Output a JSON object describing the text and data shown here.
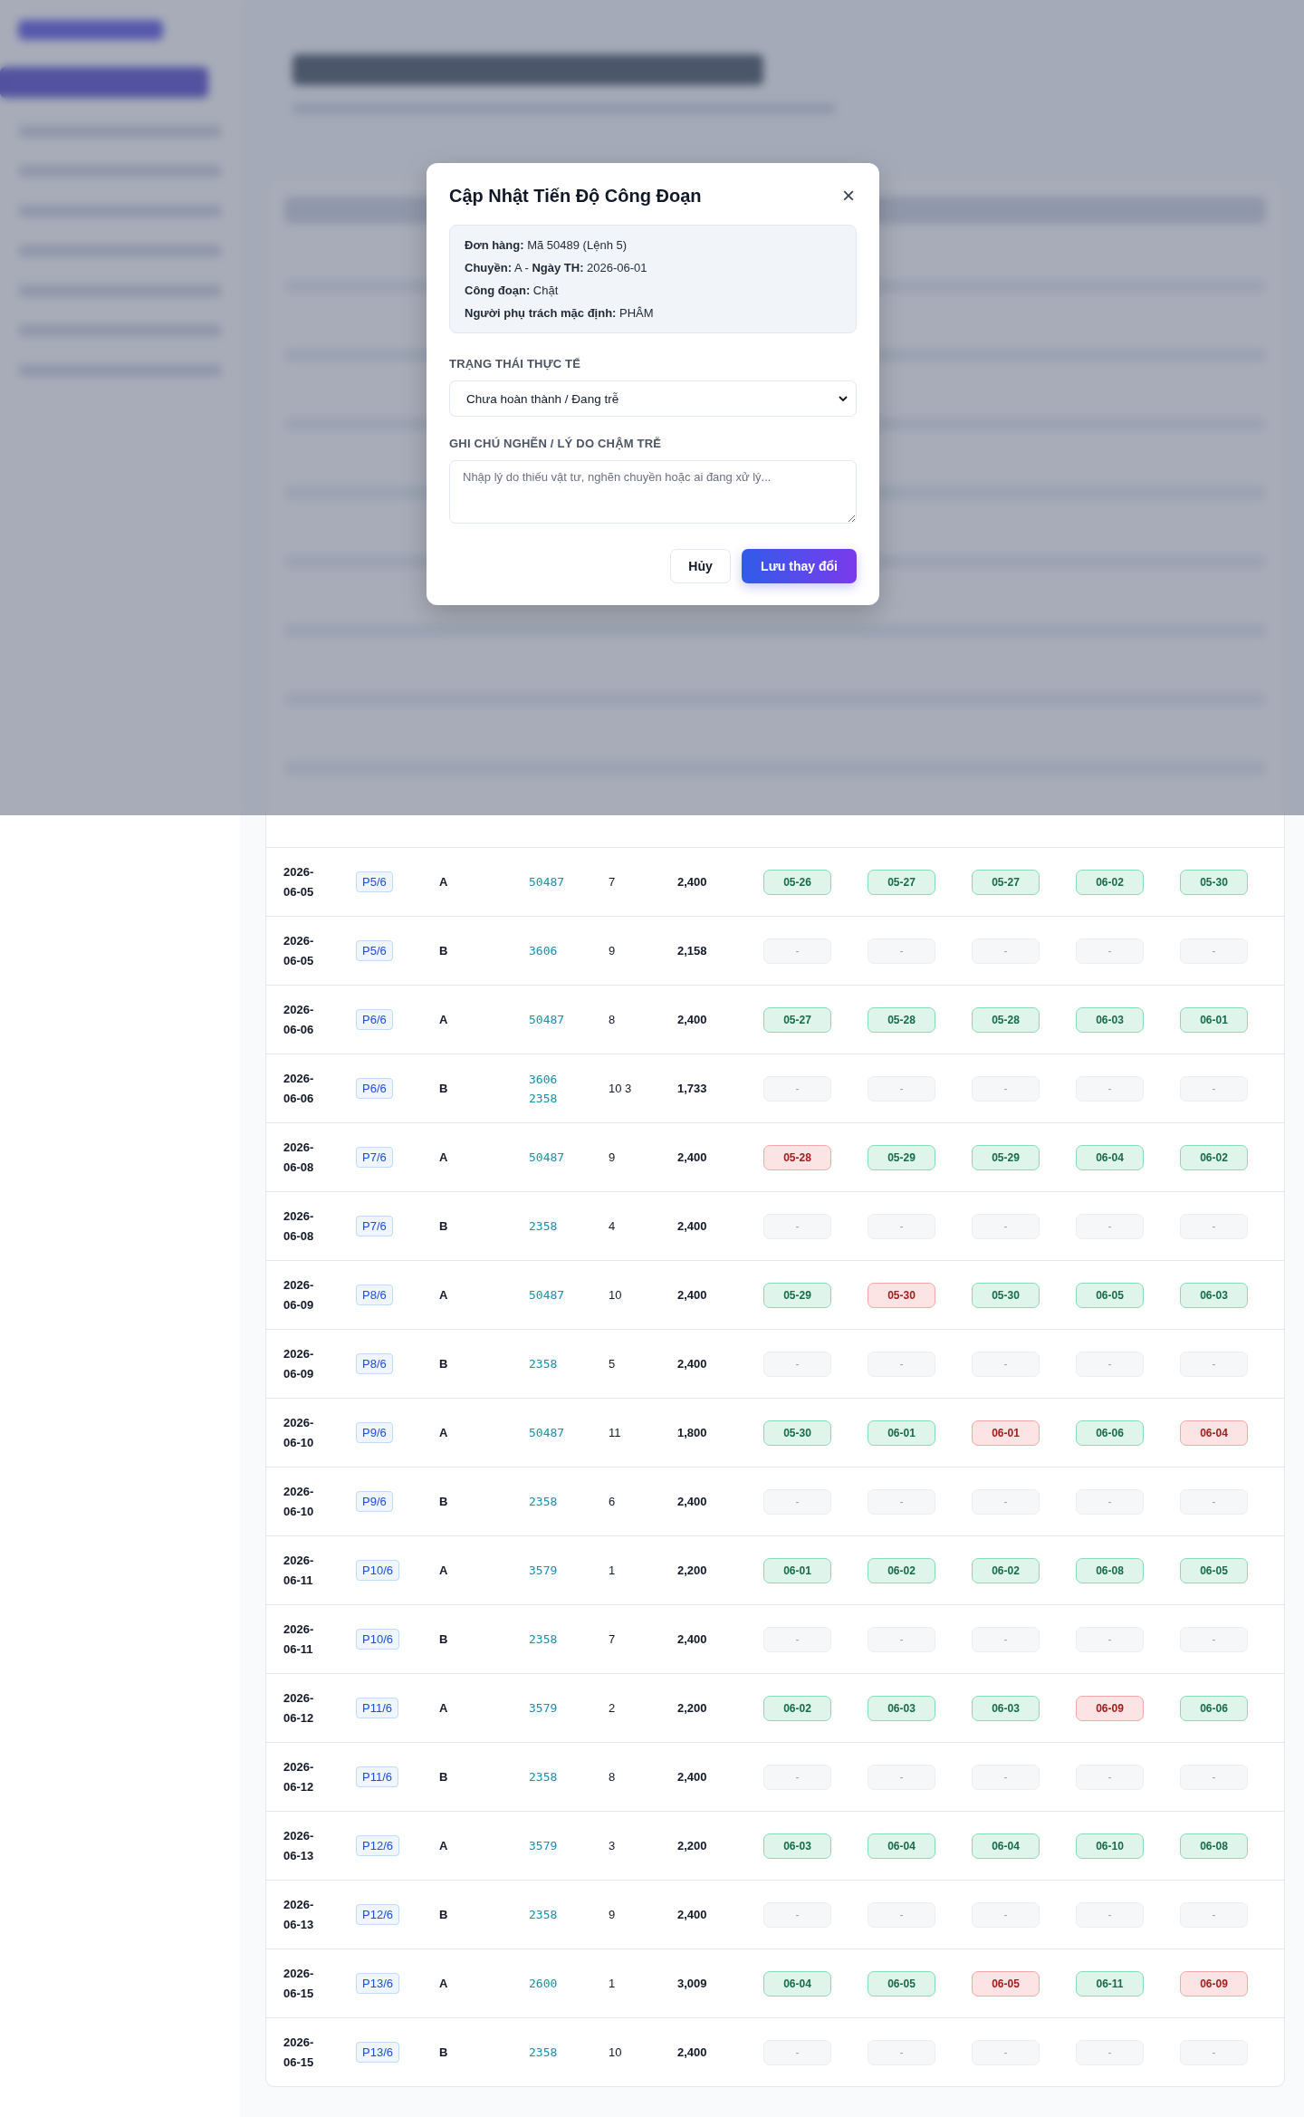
{
  "modal": {
    "title": "Cập Nhật Tiến Độ Công Đoạn",
    "close": "×",
    "info": [
      "**Đơn hàng:** Mã 50489 (Lệnh 5)",
      "**Chuyền:** A - **Ngày TH:** 2026-06-01",
      "**Công đoạn:** Chặt",
      "**Người phụ trách mặc định:** PHÂM"
    ],
    "status_label": "TRẠNG THÁI THỰC TẾ",
    "status_value": "Chưa hoàn thành / Đang trễ",
    "note_label": "GHI CHÚ NGHẼN / LÝ DO CHẬM TRỄ",
    "note_placeholder": "Nhập lý do thiếu vật tư, nghẽn chuyền hoặc ai đang xử lý...",
    "cancel": "Hủy",
    "save": "Lưu thay đổi"
  },
  "table": {
    "rows": [
      {
        "date": "2026-06-05",
        "plan": "P5/6",
        "line": "A",
        "codes": [
          "50487"
        ],
        "count": "7",
        "qty": "2,400",
        "stages": [
          {
            "text": "05-26",
            "kind": "done"
          },
          {
            "text": "05-27",
            "kind": "done"
          },
          {
            "text": "05-27",
            "kind": "done"
          },
          {
            "text": "06-02",
            "kind": "done"
          },
          {
            "text": "05-30",
            "kind": "done"
          }
        ]
      },
      {
        "date": "2026-06-05",
        "plan": "P5/6",
        "line": "B",
        "codes": [
          "3606"
        ],
        "count": "9",
        "qty": "2,158",
        "stages": [
          {
            "text": "-",
            "kind": "empty"
          },
          {
            "text": "-",
            "kind": "empty"
          },
          {
            "text": "-",
            "kind": "empty"
          },
          {
            "text": "-",
            "kind": "empty"
          },
          {
            "text": "-",
            "kind": "empty"
          }
        ]
      },
      {
        "date": "2026-06-06",
        "plan": "P6/6",
        "line": "A",
        "codes": [
          "50487"
        ],
        "count": "8",
        "qty": "2,400",
        "stages": [
          {
            "text": "05-27",
            "kind": "done"
          },
          {
            "text": "05-28",
            "kind": "done"
          },
          {
            "text": "05-28",
            "kind": "done"
          },
          {
            "text": "06-03",
            "kind": "done"
          },
          {
            "text": "06-01",
            "kind": "done"
          }
        ]
      },
      {
        "date": "2026-06-06",
        "plan": "P6/6",
        "line": "B",
        "codes": [
          "3606",
          "2358"
        ],
        "count": "10 3",
        "qty": "1,733",
        "stages": [
          {
            "text": "-",
            "kind": "empty"
          },
          {
            "text": "-",
            "kind": "empty"
          },
          {
            "text": "-",
            "kind": "empty"
          },
          {
            "text": "-",
            "kind": "empty"
          },
          {
            "text": "-",
            "kind": "empty"
          }
        ]
      },
      {
        "date": "2026-06-08",
        "plan": "P7/6",
        "line": "A",
        "codes": [
          "50487"
        ],
        "count": "9",
        "qty": "2,400",
        "stages": [
          {
            "text": "05-28",
            "kind": "late"
          },
          {
            "text": "05-29",
            "kind": "done"
          },
          {
            "text": "05-29",
            "kind": "done"
          },
          {
            "text": "06-04",
            "kind": "done"
          },
          {
            "text": "06-02",
            "kind": "done"
          }
        ]
      },
      {
        "date": "2026-06-08",
        "plan": "P7/6",
        "line": "B",
        "codes": [
          "2358"
        ],
        "count": "4",
        "qty": "2,400",
        "stages": [
          {
            "text": "-",
            "kind": "empty"
          },
          {
            "text": "-",
            "kind": "empty"
          },
          {
            "text": "-",
            "kind": "empty"
          },
          {
            "text": "-",
            "kind": "empty"
          },
          {
            "text": "-",
            "kind": "empty"
          }
        ]
      },
      {
        "date": "2026-06-09",
        "plan": "P8/6",
        "line": "A",
        "codes": [
          "50487"
        ],
        "count": "10",
        "qty": "2,400",
        "stages": [
          {
            "text": "05-29",
            "kind": "done"
          },
          {
            "text": "05-30",
            "kind": "late"
          },
          {
            "text": "05-30",
            "kind": "done"
          },
          {
            "text": "06-05",
            "kind": "done"
          },
          {
            "text": "06-03",
            "kind": "done"
          }
        ]
      },
      {
        "date": "2026-06-09",
        "plan": "P8/6",
        "line": "B",
        "codes": [
          "2358"
        ],
        "count": "5",
        "qty": "2,400",
        "stages": [
          {
            "text": "-",
            "kind": "empty"
          },
          {
            "text": "-",
            "kind": "empty"
          },
          {
            "text": "-",
            "kind": "empty"
          },
          {
            "text": "-",
            "kind": "empty"
          },
          {
            "text": "-",
            "kind": "empty"
          }
        ]
      },
      {
        "date": "2026-06-10",
        "plan": "P9/6",
        "line": "A",
        "codes": [
          "50487"
        ],
        "count": "11",
        "qty": "1,800",
        "stages": [
          {
            "text": "05-30",
            "kind": "done"
          },
          {
            "text": "06-01",
            "kind": "done"
          },
          {
            "text": "06-01",
            "kind": "late"
          },
          {
            "text": "06-06",
            "kind": "done"
          },
          {
            "text": "06-04",
            "kind": "late"
          }
        ]
      },
      {
        "date": "2026-06-10",
        "plan": "P9/6",
        "line": "B",
        "codes": [
          "2358"
        ],
        "count": "6",
        "qty": "2,400",
        "stages": [
          {
            "text": "-",
            "kind": "empty"
          },
          {
            "text": "-",
            "kind": "empty"
          },
          {
            "text": "-",
            "kind": "empty"
          },
          {
            "text": "-",
            "kind": "empty"
          },
          {
            "text": "-",
            "kind": "empty"
          }
        ]
      },
      {
        "date": "2026-06-11",
        "plan": "P10/6",
        "line": "A",
        "codes": [
          "3579"
        ],
        "count": "1",
        "qty": "2,200",
        "stages": [
          {
            "text": "06-01",
            "kind": "done"
          },
          {
            "text": "06-02",
            "kind": "done"
          },
          {
            "text": "06-02",
            "kind": "done"
          },
          {
            "text": "06-08",
            "kind": "done"
          },
          {
            "text": "06-05",
            "kind": "done"
          }
        ]
      },
      {
        "date": "2026-06-11",
        "plan": "P10/6",
        "line": "B",
        "codes": [
          "2358"
        ],
        "count": "7",
        "qty": "2,400",
        "stages": [
          {
            "text": "-",
            "kind": "empty"
          },
          {
            "text": "-",
            "kind": "empty"
          },
          {
            "text": "-",
            "kind": "empty"
          },
          {
            "text": "-",
            "kind": "empty"
          },
          {
            "text": "-",
            "kind": "empty"
          }
        ]
      },
      {
        "date": "2026-06-12",
        "plan": "P11/6",
        "line": "A",
        "codes": [
          "3579"
        ],
        "count": "2",
        "qty": "2,200",
        "stages": [
          {
            "text": "06-02",
            "kind": "done"
          },
          {
            "text": "06-03",
            "kind": "done"
          },
          {
            "text": "06-03",
            "kind": "done"
          },
          {
            "text": "06-09",
            "kind": "late"
          },
          {
            "text": "06-06",
            "kind": "done"
          }
        ]
      },
      {
        "date": "2026-06-12",
        "plan": "P11/6",
        "line": "B",
        "codes": [
          "2358"
        ],
        "count": "8",
        "qty": "2,400",
        "stages": [
          {
            "text": "-",
            "kind": "empty"
          },
          {
            "text": "-",
            "kind": "empty"
          },
          {
            "text": "-",
            "kind": "empty"
          },
          {
            "text": "-",
            "kind": "empty"
          },
          {
            "text": "-",
            "kind": "empty"
          }
        ]
      },
      {
        "date": "2026-06-13",
        "plan": "P12/6",
        "line": "A",
        "codes": [
          "3579"
        ],
        "count": "3",
        "qty": "2,200",
        "stages": [
          {
            "text": "06-03",
            "kind": "done"
          },
          {
            "text": "06-04",
            "kind": "done"
          },
          {
            "text": "06-04",
            "kind": "done"
          },
          {
            "text": "06-10",
            "kind": "done"
          },
          {
            "text": "06-08",
            "kind": "done"
          }
        ]
      },
      {
        "date": "2026-06-13",
        "plan": "P12/6",
        "line": "B",
        "codes": [
          "2358"
        ],
        "count": "9",
        "qty": "2,400",
        "stages": [
          {
            "text": "-",
            "kind": "empty"
          },
          {
            "text": "-",
            "kind": "empty"
          },
          {
            "text": "-",
            "kind": "empty"
          },
          {
            "text": "-",
            "kind": "empty"
          },
          {
            "text": "-",
            "kind": "empty"
          }
        ]
      },
      {
        "date": "2026-06-15",
        "plan": "P13/6",
        "line": "A",
        "codes": [
          "2600"
        ],
        "count": "1",
        "qty": "3,009",
        "stages": [
          {
            "text": "06-04",
            "kind": "done"
          },
          {
            "text": "06-05",
            "kind": "done"
          },
          {
            "text": "06-05",
            "kind": "late"
          },
          {
            "text": "06-11",
            "kind": "done"
          },
          {
            "text": "06-09",
            "kind": "late"
          }
        ]
      },
      {
        "date": "2026-06-15",
        "plan": "P13/6",
        "line": "B",
        "codes": [
          "2358"
        ],
        "count": "10",
        "qty": "2,400",
        "stages": [
          {
            "text": "-",
            "kind": "empty"
          },
          {
            "text": "-",
            "kind": "empty"
          },
          {
            "text": "-",
            "kind": "empty"
          },
          {
            "text": "-",
            "kind": "empty"
          },
          {
            "text": "-",
            "kind": "empty"
          }
        ]
      }
    ]
  }
}
